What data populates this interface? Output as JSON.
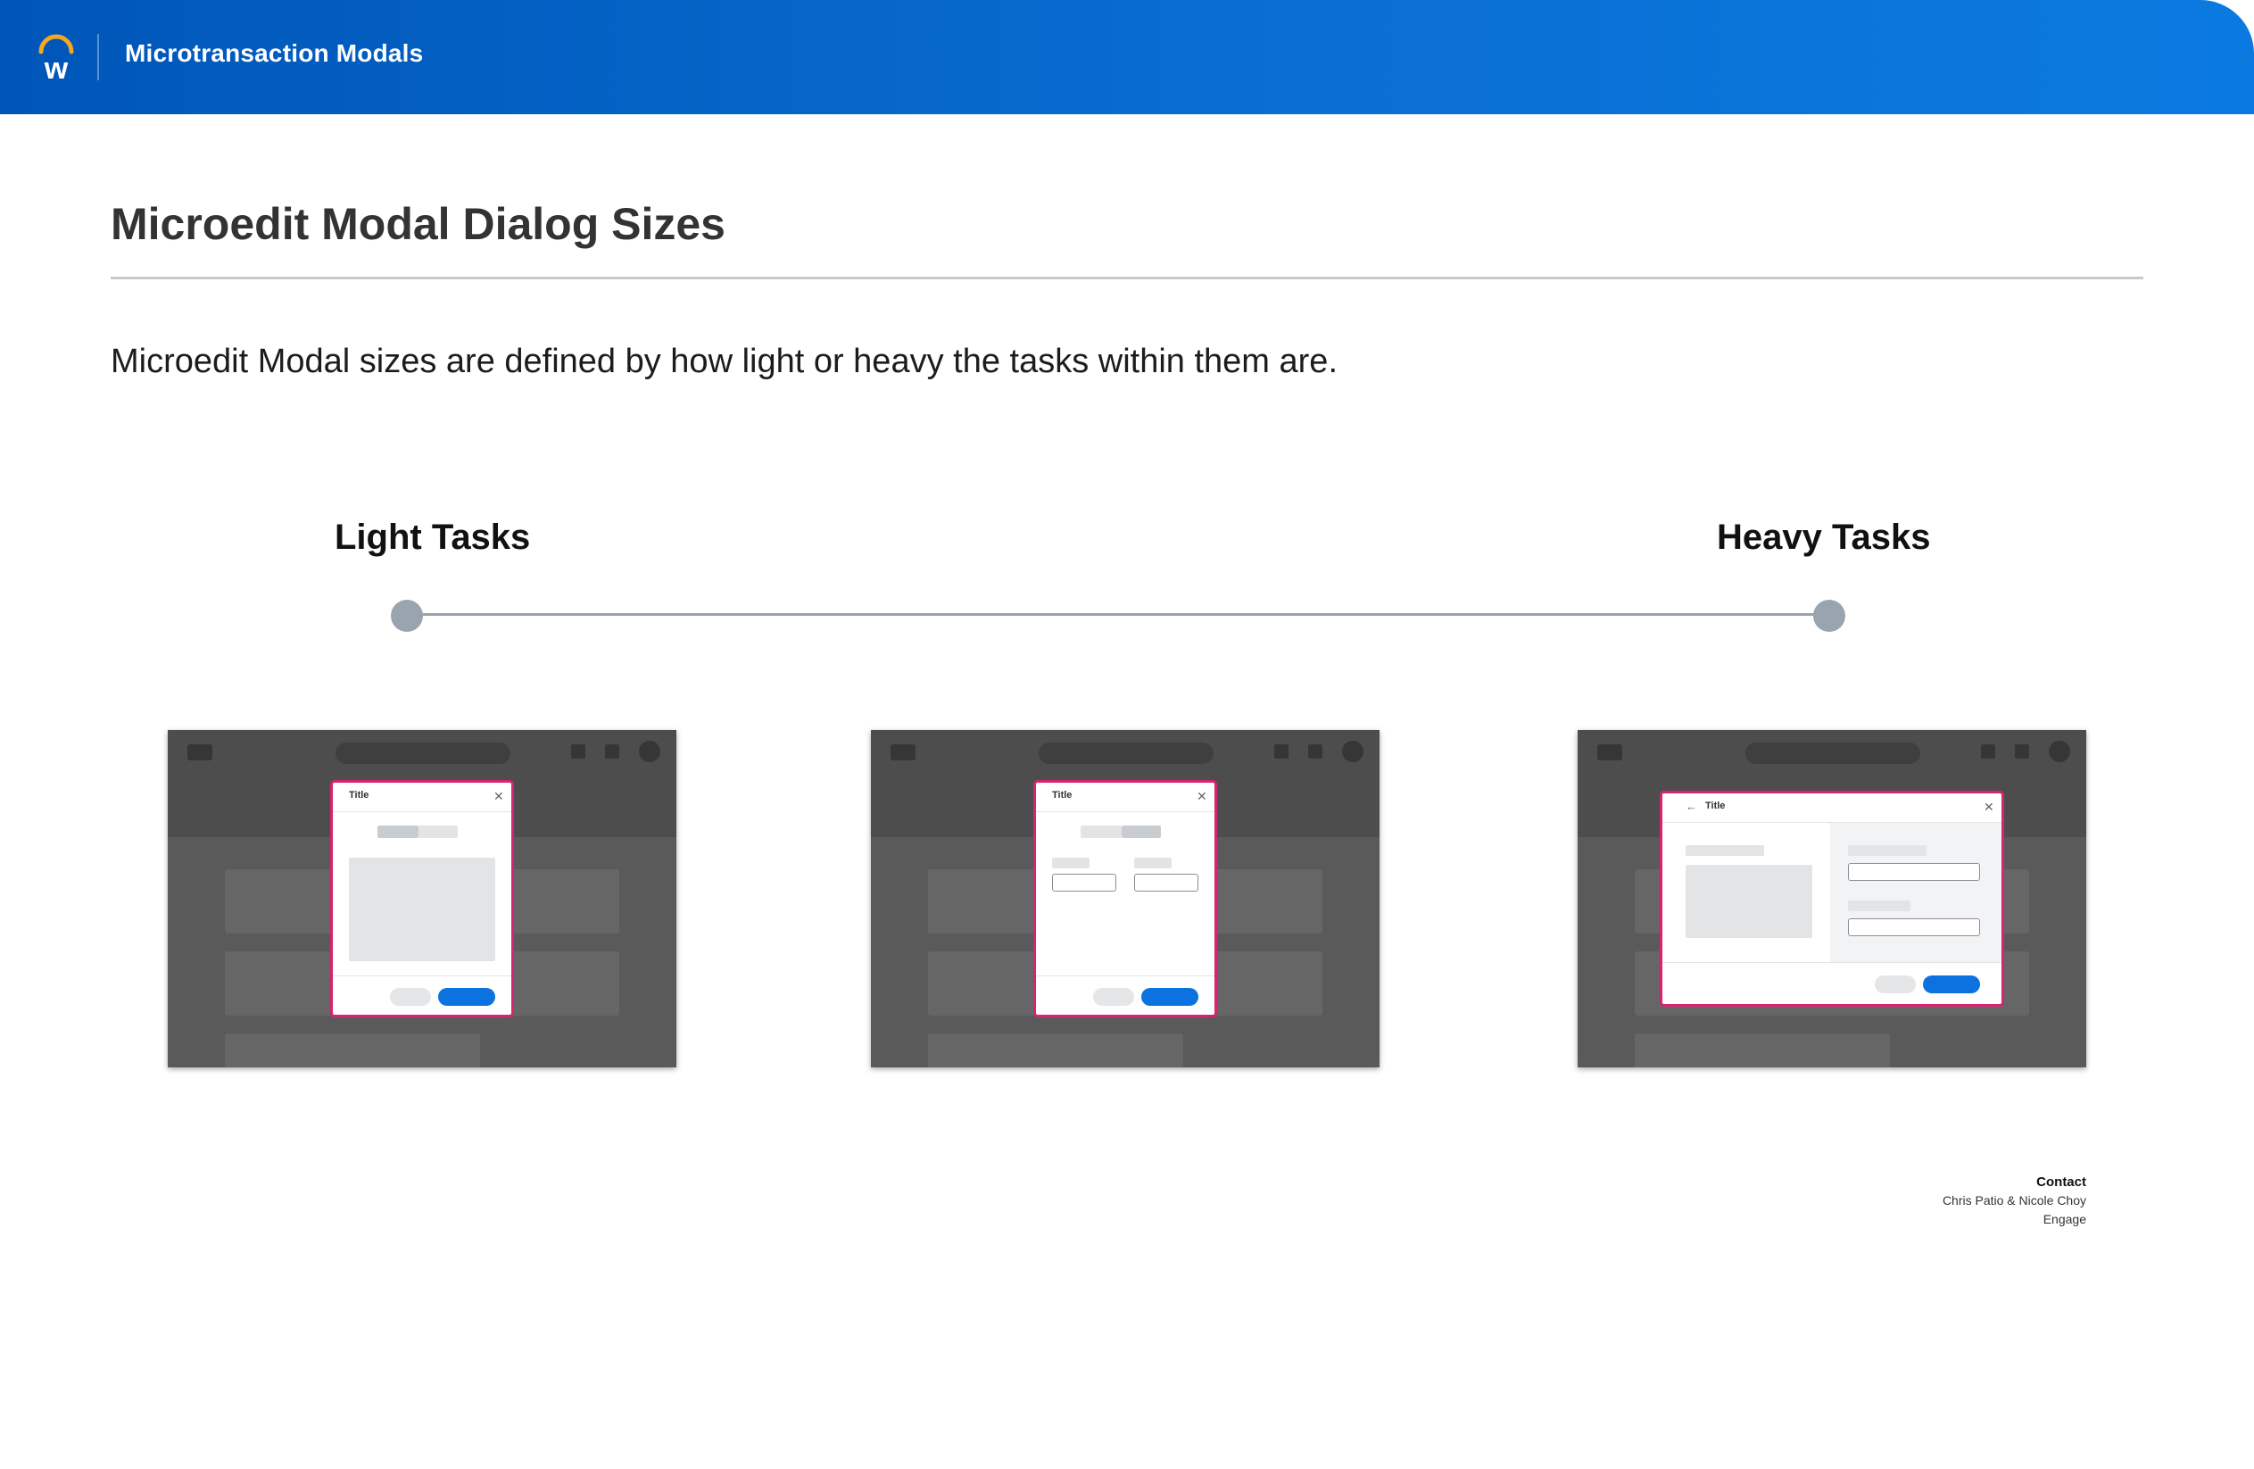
{
  "header": {
    "logo_letter": "w",
    "title": "Microtransaction Modals"
  },
  "page": {
    "title": "Microedit Modal Dialog Sizes",
    "description": "Microedit Modal sizes are defined by how light or heavy the tasks within them are."
  },
  "scale": {
    "start_label": "Light Tasks",
    "end_label": "Heavy Tasks"
  },
  "thumbnails": [
    {
      "modal_title": "Title",
      "size": "small"
    },
    {
      "modal_title": "Title",
      "size": "medium"
    },
    {
      "modal_title": "Title",
      "size": "large"
    }
  ],
  "contact": {
    "heading": "Contact",
    "names": "Chris Patio & Nicole Choy",
    "team": "Engage"
  },
  "colors": {
    "header_start": "#0056b8",
    "header_end": "#0b7ae0",
    "modal_border": "#d6246e",
    "primary_button": "#0b72e0",
    "logo_arc": "#f5a623"
  }
}
